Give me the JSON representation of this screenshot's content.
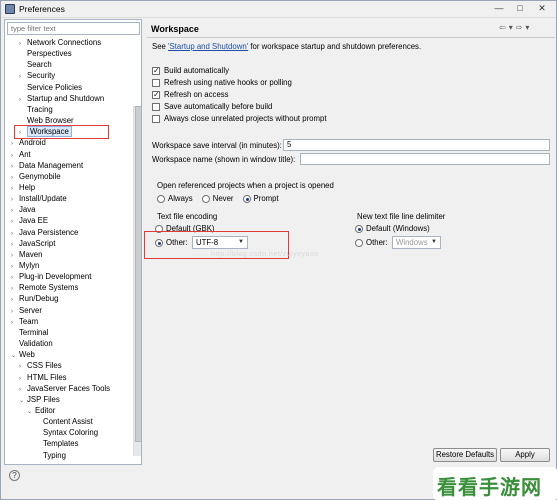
{
  "window": {
    "title": "Preferences"
  },
  "filter": {
    "placeholder": "type filter text"
  },
  "tree": [
    {
      "label": "Network Connections",
      "indent": 2,
      "arrow": "›"
    },
    {
      "label": "Perspectives",
      "indent": 2,
      "arrow": ""
    },
    {
      "label": "Search",
      "indent": 2,
      "arrow": ""
    },
    {
      "label": "Security",
      "indent": 2,
      "arrow": "›"
    },
    {
      "label": "Service Policies",
      "indent": 2,
      "arrow": ""
    },
    {
      "label": "Startup and Shutdown",
      "indent": 2,
      "arrow": "›"
    },
    {
      "label": "Tracing",
      "indent": 2,
      "arrow": ""
    },
    {
      "label": "Web Browser",
      "indent": 2,
      "arrow": ""
    },
    {
      "label": "Workspace",
      "indent": 2,
      "arrow": "›",
      "selected": true
    },
    {
      "label": "Android",
      "indent": 1,
      "arrow": "›"
    },
    {
      "label": "Ant",
      "indent": 1,
      "arrow": "›"
    },
    {
      "label": "Data Management",
      "indent": 1,
      "arrow": "›"
    },
    {
      "label": "Genymobile",
      "indent": 1,
      "arrow": "›"
    },
    {
      "label": "Help",
      "indent": 1,
      "arrow": "›"
    },
    {
      "label": "Install/Update",
      "indent": 1,
      "arrow": "›"
    },
    {
      "label": "Java",
      "indent": 1,
      "arrow": "›"
    },
    {
      "label": "Java EE",
      "indent": 1,
      "arrow": "›"
    },
    {
      "label": "Java Persistence",
      "indent": 1,
      "arrow": "›"
    },
    {
      "label": "JavaScript",
      "indent": 1,
      "arrow": "›"
    },
    {
      "label": "Maven",
      "indent": 1,
      "arrow": "›"
    },
    {
      "label": "Mylyn",
      "indent": 1,
      "arrow": "›"
    },
    {
      "label": "Plug-in Development",
      "indent": 1,
      "arrow": "›"
    },
    {
      "label": "Remote Systems",
      "indent": 1,
      "arrow": "›"
    },
    {
      "label": "Run/Debug",
      "indent": 1,
      "arrow": "›"
    },
    {
      "label": "Server",
      "indent": 1,
      "arrow": "›"
    },
    {
      "label": "Team",
      "indent": 1,
      "arrow": "›"
    },
    {
      "label": "Terminal",
      "indent": 1,
      "arrow": ""
    },
    {
      "label": "Validation",
      "indent": 1,
      "arrow": ""
    },
    {
      "label": "Web",
      "indent": 1,
      "arrow": "⌄"
    },
    {
      "label": "CSS Files",
      "indent": 2,
      "arrow": "›"
    },
    {
      "label": "HTML Files",
      "indent": 2,
      "arrow": "›"
    },
    {
      "label": "JavaServer Faces Tools",
      "indent": 2,
      "arrow": "›"
    },
    {
      "label": "JSP Files",
      "indent": 2,
      "arrow": "⌄"
    },
    {
      "label": "Editor",
      "indent": 3,
      "arrow": "⌄"
    },
    {
      "label": "Content Assist",
      "indent": 4,
      "arrow": ""
    },
    {
      "label": "Syntax Coloring",
      "indent": 4,
      "arrow": ""
    },
    {
      "label": "Templates",
      "indent": 4,
      "arrow": ""
    },
    {
      "label": "Typing",
      "indent": 4,
      "arrow": ""
    }
  ],
  "page": {
    "title": "Workspace",
    "see_prefix": "See ",
    "see_link": "'Startup and Shutdown'",
    "see_suffix": " for workspace startup and shutdown preferences.",
    "checkboxes": [
      {
        "label": "Build automatically",
        "checked": true
      },
      {
        "label": "Refresh using native hooks or polling",
        "checked": false
      },
      {
        "label": "Refresh on access",
        "checked": true
      },
      {
        "label": "Save automatically before build",
        "checked": false
      },
      {
        "label": "Always close unrelated projects without prompt",
        "checked": false
      }
    ],
    "save_interval_label": "Workspace save interval (in minutes):",
    "save_interval_value": "5",
    "workspace_name_label": "Workspace name (shown in window title):",
    "workspace_name_value": "",
    "open_ref_label": "Open referenced projects when a project is opened",
    "open_ref_options": [
      "Always",
      "Never",
      "Prompt"
    ],
    "open_ref_selected": "Prompt",
    "encoding_label": "Text file encoding",
    "encoding_default": "Default (GBK)",
    "encoding_other": "Other:",
    "encoding_value": "UTF-8",
    "delimiter_label": "New text file line delimiter",
    "delimiter_default": "Default (Windows)",
    "delimiter_other": "Other:",
    "delimiter_value": "Windows",
    "watermark": "http://blog.csdn.net/zuiyeyaoo"
  },
  "buttons": {
    "restore": "Restore Defaults",
    "apply": "Apply"
  },
  "logo": {
    "text": "看看手游网"
  }
}
